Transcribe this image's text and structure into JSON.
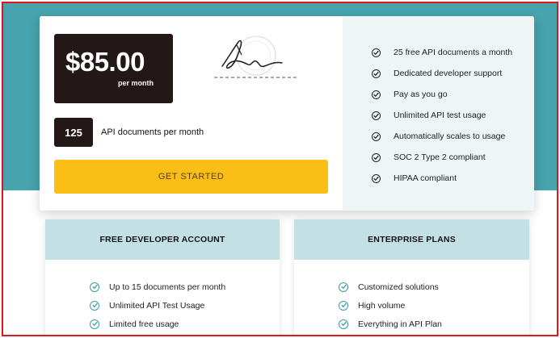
{
  "pricing": {
    "price": "$85.00",
    "period": "per month",
    "quantity": "125",
    "quantity_label": "API documents per month",
    "cta_label": "GET STARTED",
    "features": [
      "25 free API documents a month",
      "Dedicated developer support",
      "Pay as you go",
      "Unlimited API test usage",
      "Automatically scales to usage",
      "SOC 2 Type 2 compliant",
      "HIPAA compliant"
    ]
  },
  "plans": {
    "free": {
      "title": "FREE DEVELOPER ACCOUNT",
      "features": [
        "Up to 15 documents per month",
        "Unlimited API Test Usage",
        "Limited free usage"
      ]
    },
    "enterprise": {
      "title": "ENTERPRISE PLANS",
      "features": [
        "Customized solutions",
        "High volume",
        "Everything in API Plan"
      ]
    }
  },
  "icons": {
    "feature_check": "check-circle-icon",
    "plan_check": "check-circle-icon"
  },
  "colors": {
    "header_band": "#47a3ad",
    "price_box": "#231718",
    "cta": "#fbbe16",
    "plan_header": "#c3e1e5",
    "plan_check": "#3e9aa6",
    "frame_border": "#e3151b"
  }
}
